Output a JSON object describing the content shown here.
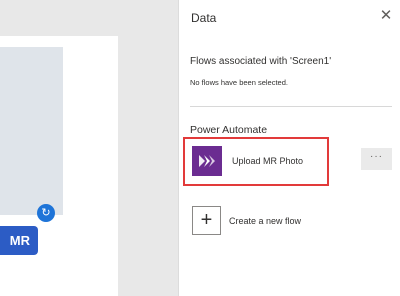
{
  "canvas": {
    "button_label": "MR"
  },
  "panel": {
    "title": "Data",
    "close_icon": "close-icon",
    "flows_heading": "Flows associated with 'Screen1'",
    "no_flows_text": "No flows have been selected.",
    "power_automate_heading": "Power Automate",
    "flow_item": {
      "label": "Upload MR Photo",
      "icon": "power-automate-icon",
      "icon_color": "#6b2c91",
      "highlight_color": "#e23a3a"
    },
    "more_button_label": "···",
    "create_flow_label": "Create a new flow"
  },
  "colors": {
    "accent_blue": "#2c5cc5",
    "rotate_blue": "#1e74d8"
  }
}
